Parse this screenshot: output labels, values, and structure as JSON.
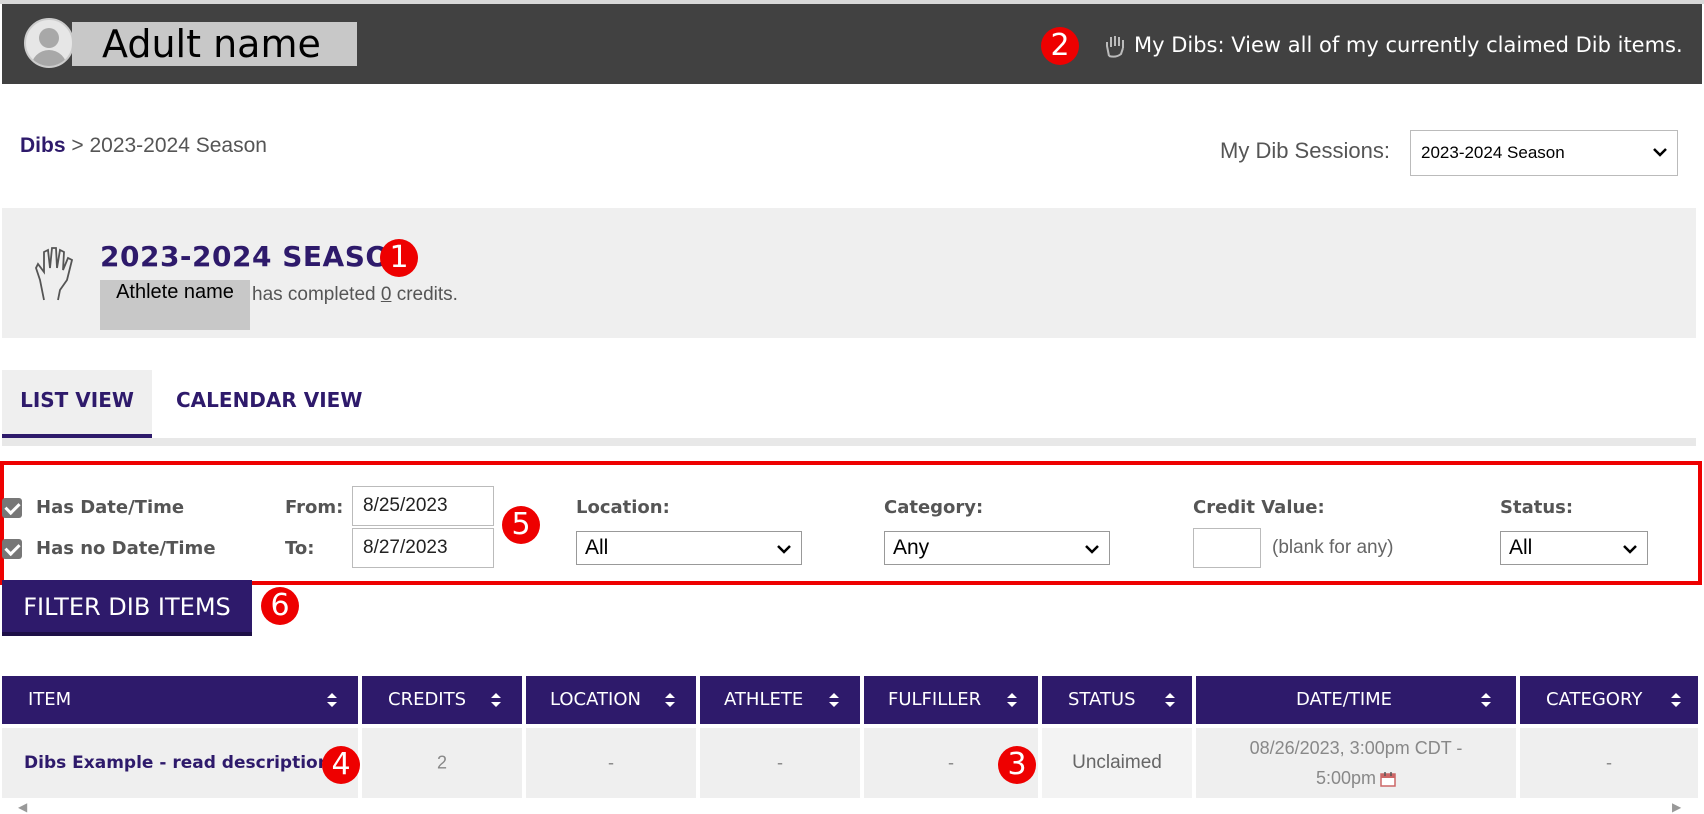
{
  "header": {
    "adult_name": "Adult name",
    "mydibs_text": "My Dibs: View all of my currently claimed Dib items."
  },
  "annotations": [
    "1",
    "2",
    "3",
    "4",
    "5",
    "6"
  ],
  "breadcrumb": {
    "root": "Dibs",
    "separator": ">",
    "current": "2023-2024 Season"
  },
  "sessions": {
    "label": "My Dib Sessions:",
    "selected": "2023-2024 Season"
  },
  "season": {
    "title": "2023-2024 SEASON",
    "athlete_name": "Athlete name",
    "completed_prefix": "has completed",
    "credits": "0",
    "completed_suffix": "credits."
  },
  "tabs": [
    {
      "label": "LIST VIEW",
      "active": true
    },
    {
      "label": "CALENDAR VIEW",
      "active": false
    }
  ],
  "filters": {
    "has_datetime_label": "Has Date/Time",
    "has_no_datetime_label": "Has no Date/Time",
    "has_datetime_checked": true,
    "has_no_datetime_checked": true,
    "from_label": "From:",
    "from_value": "8/25/2023",
    "to_label": "To:",
    "to_value": "8/27/2023",
    "location_label": "Location:",
    "location_value": "All",
    "category_label": "Category:",
    "category_value": "Any",
    "credit_label": "Credit Value:",
    "credit_value": "",
    "credit_note": "(blank for any)",
    "status_label": "Status:",
    "status_value": "All",
    "button": "FILTER DIB ITEMS"
  },
  "table": {
    "columns": [
      "ITEM",
      "CREDITS",
      "LOCATION",
      "ATHLETE",
      "FULFILLER",
      "STATUS",
      "DATE/TIME",
      "CATEGORY"
    ],
    "rows": [
      {
        "item": "Dibs Example - read description",
        "credits": "2",
        "location": "-",
        "athlete": "-",
        "fulfiller": "-",
        "status": "Unclaimed",
        "datetime_line1": "08/26/2023, 3:00pm CDT -",
        "datetime_line2": "5:00pm",
        "category": "-"
      }
    ]
  },
  "colors": {
    "brand": "#2e1a6b",
    "header_bg": "#414141",
    "annotation_red": "#ee0000"
  }
}
